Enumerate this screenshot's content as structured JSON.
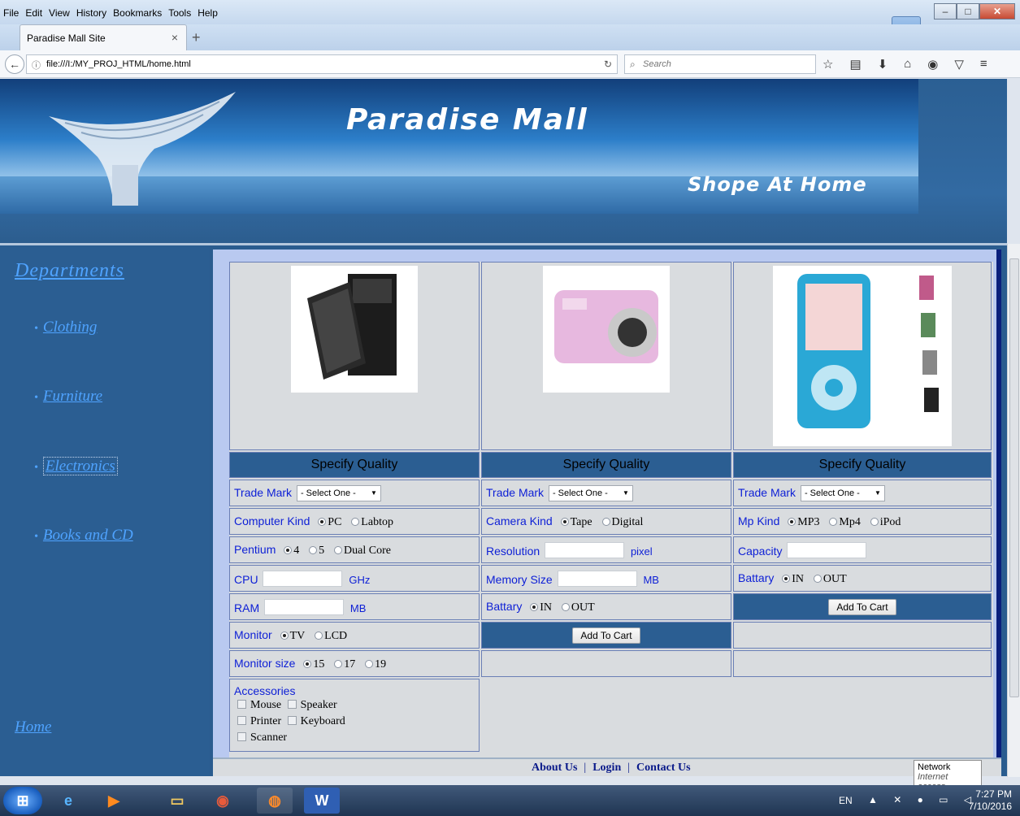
{
  "browser": {
    "menu": [
      "File",
      "Edit",
      "View",
      "History",
      "Bookmarks",
      "Tools",
      "Help"
    ],
    "tab_title": "Paradise Mall Site",
    "url": "file:///I:/MY_PROJ_HTML/home.html",
    "search_placeholder": "Search"
  },
  "header": {
    "title": "Paradise Mall",
    "tagline": "Shope At Home"
  },
  "sidebar": {
    "title": "Departments",
    "items": [
      "Clothing",
      "Furniture",
      "Electronics",
      "Books and CD"
    ],
    "home": "Home"
  },
  "products": {
    "computer": {
      "spec_header": "Specify Quality",
      "trade_mark_label": "Trade Mark",
      "trade_mark_value": "- Select One -",
      "kind_label": "Computer Kind",
      "kind_options": [
        "PC",
        "Labtop"
      ],
      "pentium_label": "Pentium",
      "pentium_options": [
        "4",
        "5",
        "Dual Core"
      ],
      "cpu_label": "CPU",
      "cpu_unit": "GHz",
      "ram_label": "RAM",
      "ram_unit": "MB",
      "monitor_label": "Monitor",
      "monitor_options": [
        "TV",
        "LCD"
      ],
      "monitor_size_label": "Monitor size",
      "monitor_size_options": [
        "15",
        "17",
        "19"
      ],
      "accessories_label": "Accessories",
      "accessories": [
        "Mouse",
        "Speaker",
        "Printer",
        "Keyboard",
        "Scanner"
      ]
    },
    "camera": {
      "spec_header": "Specify Quality",
      "trade_mark_label": "Trade Mark",
      "trade_mark_value": "- Select One -",
      "kind_label": "Camera Kind",
      "kind_options": [
        "Tape",
        "Digital"
      ],
      "resolution_label": "Resolution",
      "resolution_unit": "pixel",
      "memory_label": "Memory Size",
      "memory_unit": "MB",
      "battery_label": "Battary",
      "battery_options": [
        "IN",
        "OUT"
      ],
      "cart_button": "Add To Cart"
    },
    "mp3": {
      "spec_header": "Specify Quality",
      "trade_mark_label": "Trade Mark",
      "trade_mark_value": "- Select One -",
      "kind_label": "Mp Kind",
      "kind_options": [
        "MP3",
        "Mp4",
        "iPod"
      ],
      "capacity_label": "Capacity",
      "battery_label": "Battary",
      "battery_options": [
        "IN",
        "OUT"
      ],
      "cart_button": "Add To Cart"
    }
  },
  "footer": {
    "links": [
      "About Us",
      "Login",
      "Contact Us"
    ]
  },
  "status": {
    "tooltip_title": "Network",
    "tooltip_sub": "Internet access"
  },
  "taskbar": {
    "lang": "EN",
    "time": "7:27 PM",
    "date": "7/10/2016"
  },
  "colors": {
    "page_bg": "#2a5c8f",
    "link": "#4fa3ff",
    "label": "#0d1fd6",
    "content_border": "#0a1f7c"
  }
}
